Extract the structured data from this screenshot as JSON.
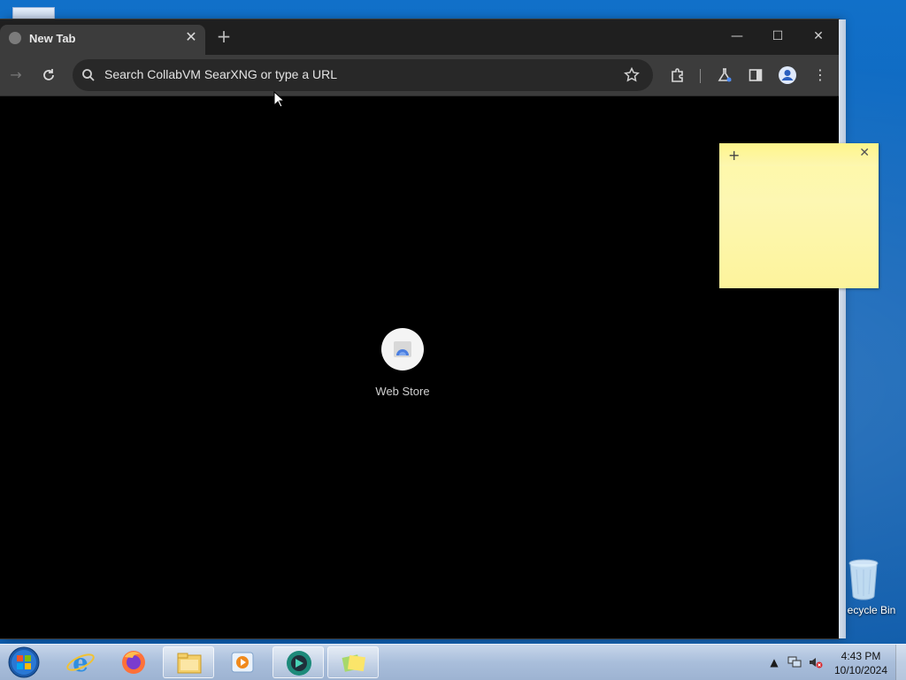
{
  "browser": {
    "tab": {
      "title": "New Tab"
    },
    "omnibox": {
      "placeholder": "Search CollabVM SearXNG or type a URL"
    },
    "shortcuts": [
      {
        "label": "Web Store",
        "icon": "chrome-web-store-icon"
      }
    ]
  },
  "desktop": {
    "recycle_bin_label": "ecycle Bin"
  },
  "taskbar": {
    "apps": [
      {
        "name": "internet-explorer-icon"
      },
      {
        "name": "firefox-icon"
      },
      {
        "name": "file-explorer-icon"
      },
      {
        "name": "media-player-icon"
      },
      {
        "name": "chrome-style-browser-icon"
      },
      {
        "name": "sticky-notes-icon"
      }
    ],
    "clock": {
      "time": "4:43 PM",
      "date": "10/10/2024"
    }
  },
  "colors": {
    "desktop_blue": "#1170c9",
    "browser_bg": "#000000",
    "toolbar": "#3c3c3c",
    "sticky_yellow": "#fdf7b2"
  }
}
